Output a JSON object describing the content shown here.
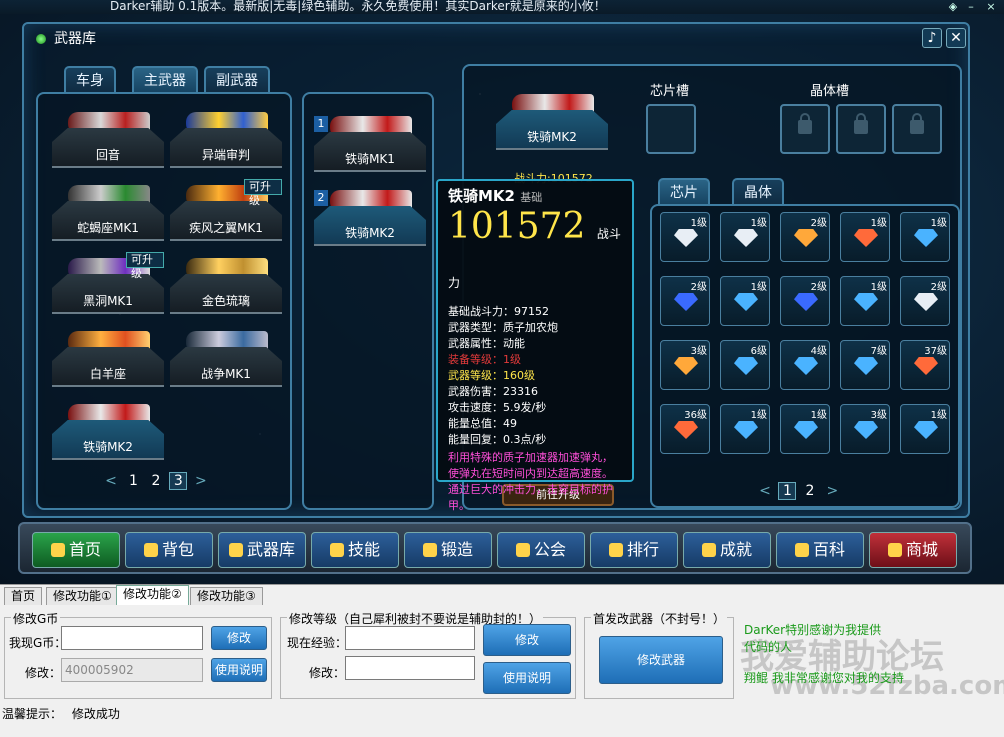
{
  "titlebar": {
    "text": "Darker辅助 0.1版本。最新版|无毒|绿色辅助。永久免费使用！其实Darker就是原来的小攸！"
  },
  "window": {
    "title": "武器库"
  },
  "tabs": {
    "body": "车身",
    "primary": "主武器",
    "secondary": "副武器"
  },
  "weapons": [
    {
      "name": "回音",
      "upgrade": ""
    },
    {
      "name": "异端审判",
      "upgrade": ""
    },
    {
      "name": "蛇蝎座MK1",
      "upgrade": ""
    },
    {
      "name": "疾风之翼MK1",
      "upgrade": "可升级"
    },
    {
      "name": "黑洞MK1",
      "upgrade": "可升级"
    },
    {
      "name": "金色琉璃",
      "upgrade": ""
    },
    {
      "name": "白羊座",
      "upgrade": ""
    },
    {
      "name": "战争MK1",
      "upgrade": ""
    },
    {
      "name": "铁骑MK2",
      "upgrade": ""
    }
  ],
  "weapon_pager": {
    "prev": "<",
    "pages": [
      "1",
      "2",
      "3"
    ],
    "next": ">"
  },
  "equipped": [
    {
      "num": "1",
      "name": "铁骑MK1"
    },
    {
      "num": "2",
      "name": "铁骑MK2"
    }
  ],
  "selected": {
    "name": "铁骑MK2",
    "power_label": "战斗力:101572"
  },
  "slots": {
    "chip_title": "芯片槽",
    "crystal_title": "晶体槽"
  },
  "chip_tabs": {
    "chip": "芯片",
    "crystal": "晶体"
  },
  "chips": [
    {
      "lvl": "1级",
      "color": "#e8eef5"
    },
    {
      "lvl": "1级",
      "color": "#e8eef5"
    },
    {
      "lvl": "2级",
      "color": "#ffa83a"
    },
    {
      "lvl": "1级",
      "color": "#ff6a3a"
    },
    {
      "lvl": "1级",
      "color": "#4ab3ff"
    },
    {
      "lvl": "2级",
      "color": "#3a6aff"
    },
    {
      "lvl": "1级",
      "color": "#4ab3ff"
    },
    {
      "lvl": "2级",
      "color": "#3a6aff"
    },
    {
      "lvl": "1级",
      "color": "#4ab3ff"
    },
    {
      "lvl": "2级",
      "color": "#e8eef5"
    },
    {
      "lvl": "3级",
      "color": "#ffa83a"
    },
    {
      "lvl": "6级",
      "color": "#4ab3ff"
    },
    {
      "lvl": "4级",
      "color": "#4ab3ff"
    },
    {
      "lvl": "7级",
      "color": "#4ab3ff"
    },
    {
      "lvl": "37级",
      "color": "#ff6a3a"
    },
    {
      "lvl": "36级",
      "color": "#ff6a3a"
    },
    {
      "lvl": "1级",
      "color": "#4ab3ff"
    },
    {
      "lvl": "1级",
      "color": "#4ab3ff"
    },
    {
      "lvl": "3级",
      "color": "#4ab3ff"
    },
    {
      "lvl": "1级",
      "color": "#4ab3ff"
    }
  ],
  "chip_pager": {
    "prev": "<",
    "pages": [
      "1",
      "2"
    ],
    "next": ">"
  },
  "tooltip": {
    "name": "铁骑MK2",
    "tag": "基础",
    "power": "101572",
    "power_unit": "战斗力",
    "lines": [
      {
        "text": "基础战斗力：97152",
        "cls": ""
      },
      {
        "text": "武器类型：质子加农炮",
        "cls": ""
      },
      {
        "text": "武器属性：动能",
        "cls": ""
      },
      {
        "text": "装备等级：1级",
        "cls": "red"
      },
      {
        "text": "武器等级：160级",
        "cls": "yellow"
      },
      {
        "text": "武器伤害：23316",
        "cls": ""
      },
      {
        "text": "攻击速度：5.9发/秒",
        "cls": ""
      },
      {
        "text": "能量总值：49",
        "cls": ""
      },
      {
        "text": "能量回复：0.3点/秒",
        "cls": ""
      }
    ],
    "desc": "利用特殊的质子加速器加速弹丸，使弹丸在短时间内到达超高速度。通过巨大的冲击力，击穿目标的护甲。"
  },
  "hidden_button": "前往升级",
  "nav": [
    "首页",
    "背包",
    "武器库",
    "技能",
    "锻造",
    "公会",
    "排行",
    "成就",
    "百科",
    "商城"
  ],
  "tool_tabs": [
    "首页",
    "修改功能①",
    "修改功能②",
    "修改功能③"
  ],
  "g_coin": {
    "title": "修改G币",
    "current_label": "我现G币：",
    "modify_label": "修改：",
    "modify_value": "400005902",
    "modify_btn": "修改",
    "help_btn": "使用说明"
  },
  "level": {
    "title": "修改等级（自己犀利被封不要说是辅助封的！）",
    "exp_label": "现在经验：",
    "modify_label": "修改：",
    "modify_btn": "修改",
    "help_btn": "使用说明"
  },
  "first_weapon": {
    "title": "首发改武器（不封号！）",
    "btn": "修改武器"
  },
  "thanks": {
    "line1": "DarKer特别感谢为我提供代码的人",
    "line2": "翔鲲   我非常感谢您对我的支持"
  },
  "watermark": {
    "cn": "我爱辅助论坛",
    "url": "www.52fzba.com"
  },
  "status": {
    "label": "温馨提示：",
    "text": "修改成功"
  }
}
